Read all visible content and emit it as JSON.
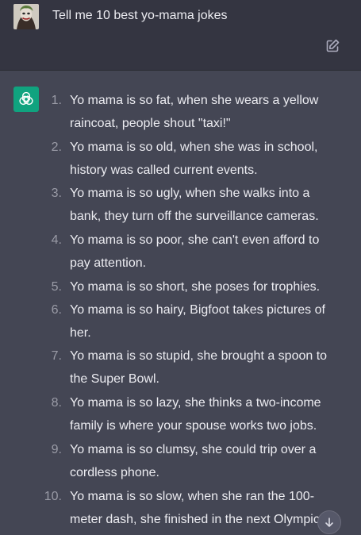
{
  "user_message": {
    "text": "Tell me 10 best yo-mama jokes",
    "avatar": "joker-portrait"
  },
  "icons": {
    "edit": "edit-pencil-icon",
    "assistant": "openai-logo-icon",
    "scroll": "arrow-down-icon"
  },
  "colors": {
    "user_bg": "#343541",
    "assistant_bg": "#444654",
    "logo_bg": "#10a37f",
    "text": "#ececf1"
  },
  "jokes": [
    {
      "num": "1.",
      "line1": "Yo mama is so fat, when she wears a yellow",
      "line2": "raincoat, people shout \"taxi!\""
    },
    {
      "num": "2.",
      "line1": "Yo mama is so old, when she was in school,",
      "line2": "history was called current events."
    },
    {
      "num": "3.",
      "line1": "Yo mama is so ugly, when she walks into a",
      "line2": "bank, they turn off the surveillance cameras."
    },
    {
      "num": "4.",
      "line1": "Yo mama is so poor, she can't even afford to",
      "line2": "pay attention."
    },
    {
      "num": "5.",
      "line1": "Yo mama is so short, she poses for trophies.",
      "line2": ""
    },
    {
      "num": "6.",
      "line1": "Yo mama is so hairy, Bigfoot takes pictures of",
      "line2": "her."
    },
    {
      "num": "7.",
      "line1": "Yo mama is so stupid, she brought a spoon to",
      "line2": "the Super Bowl."
    },
    {
      "num": "8.",
      "line1": "Yo mama is so lazy, she thinks a two-income",
      "line2": "family is where your spouse works two jobs."
    },
    {
      "num": "9.",
      "line1": "Yo mama is so clumsy, she could trip over a",
      "line2": "cordless phone."
    },
    {
      "num": "10.",
      "line1": "Yo mama is so slow, when she ran the 100-",
      "line2": "meter dash, she finished in the next Olympics."
    }
  ]
}
